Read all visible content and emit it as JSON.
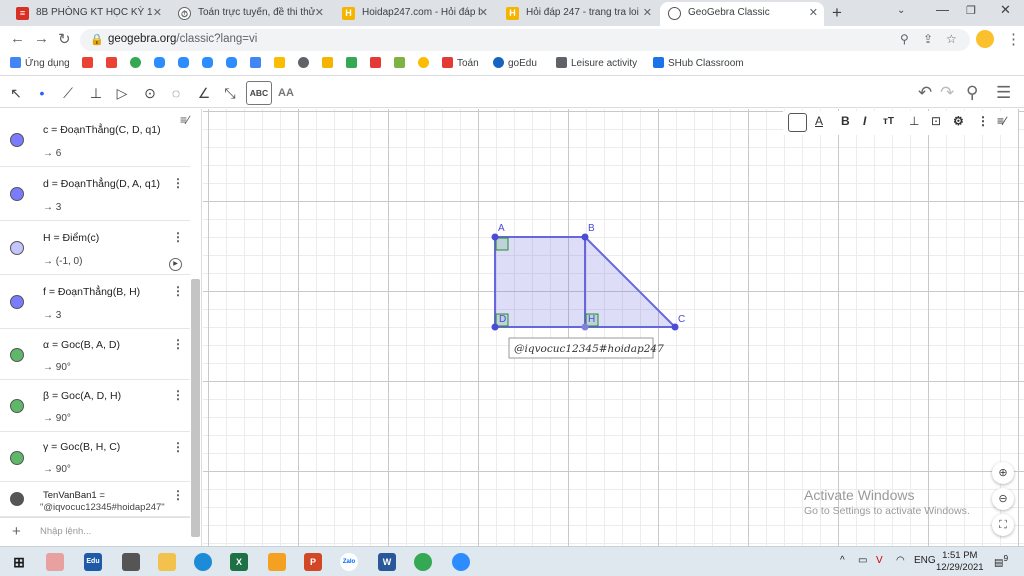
{
  "browser": {
    "tabs": [
      {
        "title": "8B PHÒNG KT HỌC KỲ 1 - Th",
        "icon": "form-icon",
        "color": "#d93025"
      },
      {
        "title": "Toán trực tuyến, đề thi thử to",
        "icon": "timer-icon",
        "color": "#5f6368"
      },
      {
        "title": "Hoidap247.com - Hỏi đáp bà",
        "icon": "hoidap-icon",
        "color": "#f4b400"
      },
      {
        "title": "Hỏi đáp 247 - trang tra loi",
        "icon": "hoidap-icon",
        "color": "#f4b400"
      },
      {
        "title": "GeoGebra Classic",
        "icon": "geogebra-icon",
        "color": "#555555"
      }
    ],
    "url_host": "geogebra.org",
    "url_path": "/classic?lang=vi"
  },
  "bookmarks": [
    {
      "label": "Ứng dụng",
      "color": "#4285f4"
    },
    {
      "label": "",
      "color": "#ea4335"
    },
    {
      "label": "",
      "color": "#ea4335"
    },
    {
      "label": "",
      "color": "#34a853"
    },
    {
      "label": "",
      "color": "#2d8cff"
    },
    {
      "label": "",
      "color": "#2d8cff"
    },
    {
      "label": "",
      "color": "#2d8cff"
    },
    {
      "label": "",
      "color": "#2d8cff"
    },
    {
      "label": "",
      "color": "#4285f4"
    },
    {
      "label": "",
      "color": "#fbbc04"
    },
    {
      "label": "",
      "color": "#5f6368"
    },
    {
      "label": "",
      "color": "#f4b400"
    },
    {
      "label": "",
      "color": "#34a853"
    },
    {
      "label": "",
      "color": "#e53935"
    },
    {
      "label": "",
      "color": "#7cb342"
    },
    {
      "label": "",
      "color": "#fbbc04"
    },
    {
      "label": "Toán",
      "color": "#e53935"
    },
    {
      "label": "goEdu",
      "color": "#1565c0"
    },
    {
      "label": "Leisure activity",
      "color": "#5f6368"
    },
    {
      "label": "SHub Classroom",
      "color": "#1a73e8"
    }
  ],
  "toolbar": {
    "text_tool": "ABC",
    "style_tool": "AA"
  },
  "algebra": {
    "items": [
      {
        "def": "c = ĐoạnThẳng(C, D, q1)",
        "val": "→ 6",
        "color": "#7b7bff"
      },
      {
        "def": "d = ĐoạnThẳng(D, A, q1)",
        "val": "→ 3",
        "color": "#7b7bff"
      },
      {
        "def": "H = Điểm(c)",
        "val": "→ (-1, 0)",
        "color": "#c4c4ff"
      },
      {
        "def": "f = ĐoạnThẳng(B, H)",
        "val": "→ 3",
        "color": "#7b7bff"
      },
      {
        "def": "α = Goc(B, A, D)",
        "val": "→ 90°",
        "color": "#5fb86a"
      },
      {
        "def": "β = Goc(A, D, H)",
        "val": "→ 90°",
        "color": "#5fb86a"
      },
      {
        "def": "γ = Goc(B, H, C)",
        "val": "→ 90°",
        "color": "#5fb86a"
      },
      {
        "def": "TenVanBan1 =",
        "val": "\"@iqvocuc12345#hoidap247\"",
        "color": "#555555"
      }
    ],
    "input_placeholder": "Nhập lệnh..."
  },
  "graphics": {
    "points": [
      {
        "name": "A"
      },
      {
        "name": "B"
      },
      {
        "name": "C"
      },
      {
        "name": "D"
      },
      {
        "name": "H"
      }
    ],
    "text_box": "@iqvocuc12345#hoidap247",
    "polygon_color": "#6666dd",
    "angle_color": "#1f8f2f"
  },
  "watermark": {
    "line1": "Activate Windows",
    "line2": "Go to Settings to activate Windows."
  },
  "taskbar": {
    "language": "ENG",
    "time": "1:51 PM",
    "date": "12/29/2021",
    "notifications": "9"
  }
}
